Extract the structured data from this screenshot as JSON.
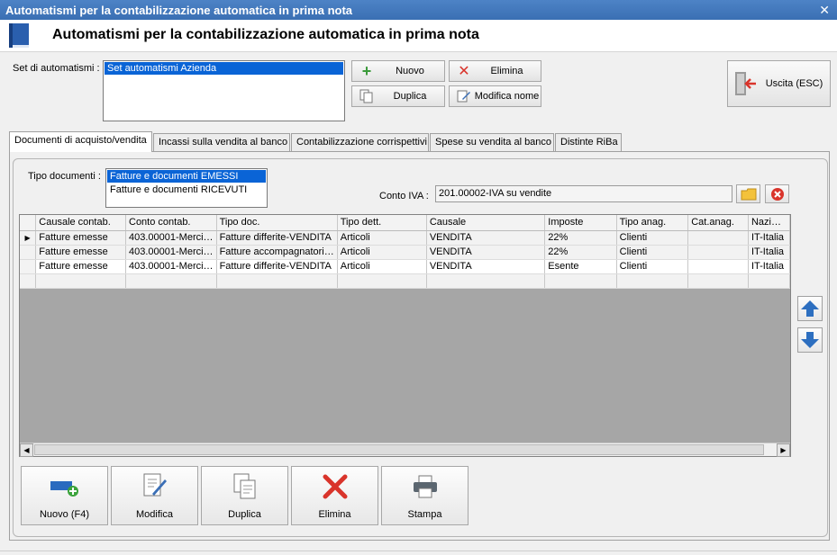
{
  "window": {
    "title": "Automatismi per la contabilizzazione automatica in prima nota"
  },
  "header": {
    "title": "Automatismi per la contabilizzazione automatica in prima nota"
  },
  "set": {
    "label": "Set di automatismi :",
    "items": [
      "Set automatismi Azienda"
    ]
  },
  "toolbar": {
    "nuovo": "Nuovo",
    "elimina": "Elimina",
    "duplica": "Duplica",
    "modifica_nome": "Modifica nome",
    "uscita": "Uscita (ESC)"
  },
  "tabs": [
    "Documenti di acquisto/vendita",
    "Incassi sulla vendita al banco",
    "Contabilizzazione corrispettivi",
    "Spese su vendita al banco",
    "Distinte RiBa"
  ],
  "tipo_documenti": {
    "label": "Tipo documenti :",
    "items": [
      "Fatture e documenti EMESSI",
      "Fatture e documenti RICEVUTI"
    ]
  },
  "conto_iva": {
    "label": "Conto IVA :",
    "value": "201.00002-IVA su vendite"
  },
  "grid": {
    "columns": [
      "Causale contab.",
      "Conto contab.",
      "Tipo doc.",
      "Tipo dett.",
      "Causale",
      "Imposte",
      "Tipo anag.",
      "Cat.anag.",
      "Nazione"
    ],
    "rows": [
      [
        "Fatture emesse",
        "403.00001-Merci…",
        "Fatture differite-VENDITA",
        "Articoli",
        "VENDITA",
        "22%",
        "Clienti",
        "",
        "IT-Italia"
      ],
      [
        "Fatture emesse",
        "403.00001-Merci…",
        "Fatture accompagnatori…",
        "Articoli",
        "VENDITA",
        "22%",
        "Clienti",
        "",
        "IT-Italia"
      ],
      [
        "Fatture emesse",
        "403.00001-Merci…",
        "Fatture differite-VENDITA",
        "Articoli",
        "VENDITA",
        "Esente",
        "Clienti",
        "",
        "IT-Italia"
      ]
    ]
  },
  "actions": {
    "nuovo": "Nuovo (F4)",
    "modifica": "Modifica",
    "duplica": "Duplica",
    "elimina": "Elimina",
    "stampa": "Stampa"
  },
  "colors": {
    "accent": "#0a64d6",
    "titlebar": "#4477bd",
    "danger": "#d9342b",
    "arrow": "#2d6fc0"
  }
}
